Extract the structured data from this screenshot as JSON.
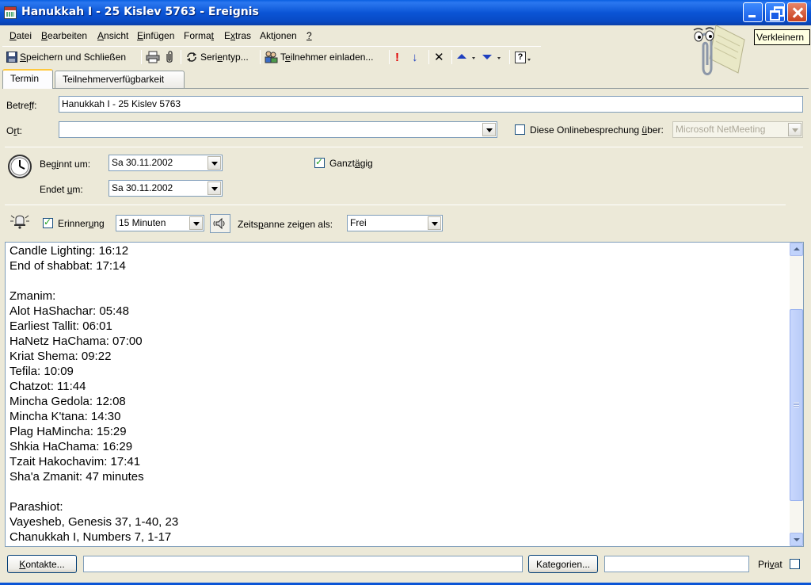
{
  "window": {
    "title": "Hanukkah I - 25 Kislev 5763 - Ereignis",
    "tooltip": "Verkleinern"
  },
  "menu": [
    {
      "pre": "",
      "u": "D",
      "post": "atei"
    },
    {
      "pre": "",
      "u": "B",
      "post": "earbeiten"
    },
    {
      "pre": "",
      "u": "A",
      "post": "nsicht"
    },
    {
      "pre": "",
      "u": "E",
      "post": "infügen"
    },
    {
      "pre": "Forma",
      "u": "t",
      "post": ""
    },
    {
      "pre": "E",
      "u": "x",
      "post": "tras"
    },
    {
      "pre": "Akt",
      "u": "i",
      "post": "onen"
    },
    {
      "pre": "",
      "u": "?",
      "post": ""
    }
  ],
  "toolbar": {
    "save_close_pre": "",
    "save_close_u": "S",
    "save_close_post": "peichern und Schließen",
    "recurrence_pre": "Seri",
    "recurrence_u": "e",
    "recurrence_post": "ntyp...",
    "invite_pre": "T",
    "invite_u": "e",
    "invite_post": "ilnehmer einladen...",
    "importance_high": "!",
    "importance_low": "↓",
    "delete": "✕",
    "help": "?"
  },
  "tabs": [
    {
      "label": "Termin"
    },
    {
      "label": "Teilnehmerverfügbarkeit"
    }
  ],
  "form": {
    "subject_label_pre": "Betre",
    "subject_label_u": "f",
    "subject_label_post": "f:",
    "subject_value": "Hanukkah I - 25 Kislev 5763",
    "location_label_pre": "O",
    "location_label_u": "r",
    "location_label_post": "t:",
    "location_value": "",
    "online_pre": "Diese Onlinebesprechung ",
    "online_u": "ü",
    "online_post": "ber:",
    "online_value": "Microsoft NetMeeting",
    "online_checked": false,
    "start_label_pre": "Beg",
    "start_label_u": "i",
    "start_label_post": "nnt um:",
    "start_value": "Sa 30.11.2002",
    "end_label_pre": "Endet ",
    "end_label_u": "u",
    "end_label_post": "m:",
    "end_value": "Sa 30.11.2002",
    "allday_pre": "Ganzt",
    "allday_u": "ä",
    "allday_post": "gig",
    "allday_checked": true,
    "reminder_pre": "Erinner",
    "reminder_u": "u",
    "reminder_post": "ng",
    "reminder_checked": true,
    "reminder_value": "15 Minuten",
    "showas_pre": "Zeits",
    "showas_u": "p",
    "showas_post": "anne zeigen als:",
    "showas_value": "Frei"
  },
  "body_lines": [
    "Candle Lighting: 16:12",
    "End of shabbat: 17:14",
    "",
    "Zmanim:",
    "Alot HaShachar: 05:48",
    "Earliest Tallit: 06:01",
    "HaNetz HaChama: 07:00",
    "Kriat Shema: 09:22",
    "Tefila: 10:09",
    "Chatzot: 11:44",
    "Mincha Gedola: 12:08",
    "Mincha K'tana: 14:30",
    "Plag HaMincha: 15:29",
    "Shkia HaChama: 16:29",
    "Tzait Hakochavim: 17:41",
    "Sha'a Zmanit: 47 minutes",
    "",
    "Parashiot:",
    "Vayesheb, Genesis 37, 1-40, 23",
    "Chanukkah I, Numbers 7, 1-17"
  ],
  "footer": {
    "contacts_pre": "",
    "contacts_u": "K",
    "contacts_post": "ontakte...",
    "contacts_value": "",
    "categories_pre": "Kate",
    "categories_u": "g",
    "categories_post": "orien...",
    "categories_value": "",
    "private_pre": "Pri",
    "private_u": "v",
    "private_post": "at",
    "private_checked": false
  },
  "colors": {
    "titlebar": "#0B55D6",
    "close_button": "#D9532C",
    "window_bg": "#ECE9D8",
    "field_border": "#7F9DB9",
    "tab_highlight": "#FFC83C"
  }
}
